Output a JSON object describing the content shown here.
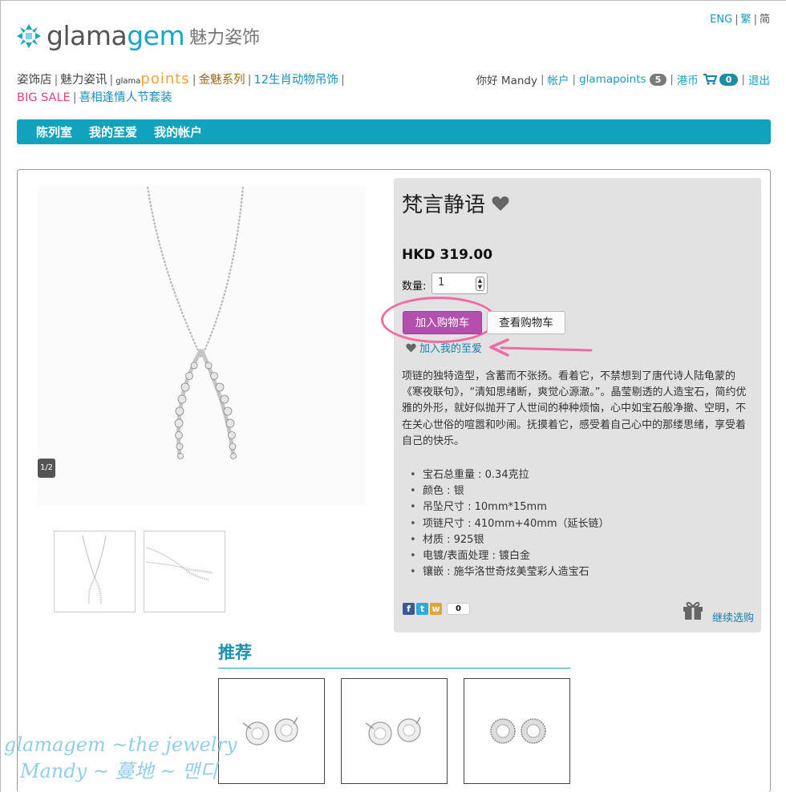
{
  "lang": {
    "eng": "ENG",
    "trad": "繁",
    "simp": "简"
  },
  "logo": {
    "word_a": "glama",
    "word_b": "gem",
    "chinese": "魅力姿饰"
  },
  "topnav": {
    "items": [
      "姿饰店",
      "魅力姿讯"
    ],
    "points_small": "glama",
    "points_big": "points",
    "gold_series": "金魅系列",
    "zodiac": "12生肖动物吊饰",
    "big_sale": "BIG SALE",
    "valentine": "喜相逢情人节套装"
  },
  "usernav": {
    "greeting": "你好 Mandy",
    "account": "帐户",
    "glamapoints": "glamapoints",
    "points_count": "5",
    "currency": "港币",
    "cart_count": "0",
    "logout": "退出"
  },
  "bluebar": {
    "items": [
      "陈列室",
      "我的至爱",
      "我的帐户"
    ]
  },
  "gallery": {
    "counter": "1/2"
  },
  "product": {
    "title": "梵言静语",
    "price": "HKD 319.00",
    "qty_label": "数量:",
    "qty_value": "1",
    "add_to_cart": "加入购物车",
    "view_cart": "查看购物车",
    "add_favorite": "加入我的至爱",
    "description": "项链的独特造型，含蓄而不张扬。看着它，不禁想到了唐代诗人陆龟蒙的《寒夜联句》，“清知思绪断，爽觉心源澈。”。晶莹剔透的人造宝石，简约优雅的外形，就好似抛开了人世间的种种烦恼，心中如宝石般净撤、空明，不在关心世俗的喧嚣和吵闹。抚摸着它，感受着自己心中的那缕思绪，享受着自己的快乐。",
    "specs": [
      "宝石总重量 : 0.34克拉",
      "颜色 : 银",
      "吊坠尺寸 : 10mm*15mm",
      "项链尺寸 : 410mm+40mm（延长链）",
      "材质 : 925银",
      "电镀/表面处理 : 镀白金",
      "镶嵌 : 施华洛世奇炫美莹彩人造宝石"
    ],
    "share_count": "0",
    "continue_shopping": "继续选购"
  },
  "recommend": {
    "title": "推荐"
  },
  "watermark": {
    "line1": "glamagem ~the jewelry",
    "line2": "Mandy ~ 蔓地 ~ 맨디"
  },
  "colors": {
    "teal": "#11a3bd",
    "purple_button": "#b54fae",
    "highlight_pink": "#f06ba3",
    "link_blue": "#1a7fb0"
  }
}
